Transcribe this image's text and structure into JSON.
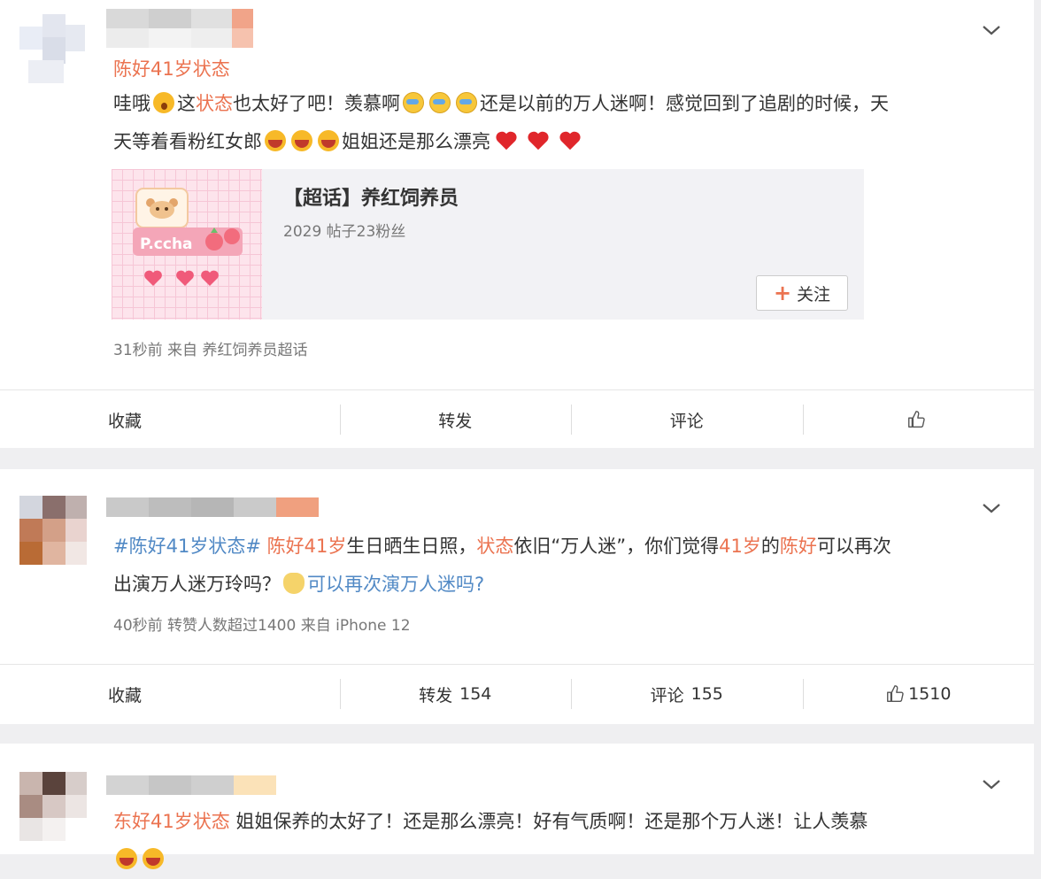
{
  "posts": [
    {
      "hashtag": "陈好41岁状态",
      "text": {
        "p1": "哇哦",
        "p2": "这",
        "p3": "状态",
        "p4": "也太好了吧！羡慕啊",
        "p5": "还是以前的万人迷啊！感觉回到了追剧的时候，天",
        "p6": "天等着看粉红女郎",
        "p7": "姐姐还是那么漂亮"
      },
      "topic": {
        "title": "【超话】养红饲养员",
        "subtitle": "2029 帖子23粉丝",
        "image_text": "P.ccha",
        "follow_label": "关注"
      },
      "meta": "31秒前  来自 养红饲养员超话",
      "actions": {
        "fav": "收藏",
        "repost": "转发",
        "comment": "评论",
        "like": ""
      }
    },
    {
      "text": {
        "t1": "#陈好41岁状态#",
        "t2": " ",
        "t3": "陈好41岁",
        "t4": "生日晒生日照，",
        "t5": "状态",
        "t6": "依旧“万人迷”，你们觉得",
        "t7": "41岁",
        "t8": "的",
        "t9": "陈好",
        "t10": "可以再次",
        "line2a": "出演万人迷万玲吗？",
        "line2b": "可以再次演万人迷吗?"
      },
      "meta": "40秒前 转赞人数超过1400  来自 iPhone 12",
      "actions": {
        "fav": "收藏",
        "repost": "转发",
        "repost_count": "154",
        "comment": "评论",
        "comment_count": "155",
        "like_count": "1510"
      }
    },
    {
      "hashtag": "东好41岁状态",
      "text": "姐姐保养的太好了！还是那么漂亮！好有气质啊！还是那个万人迷！让人羡慕"
    }
  ]
}
